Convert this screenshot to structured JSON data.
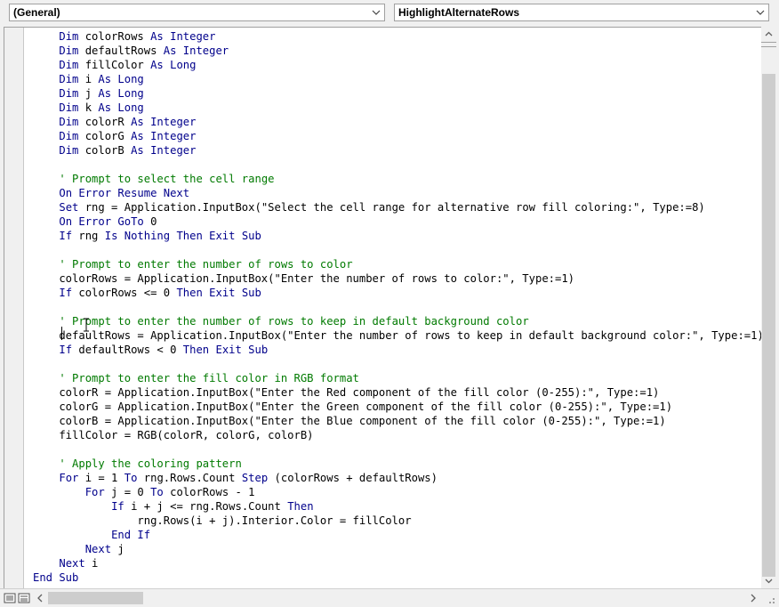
{
  "toolbar": {
    "object_combo": "(General)",
    "procedure_combo": "HighlightAlternateRows"
  },
  "code": {
    "lines": [
      [
        {
          "t": "    "
        },
        {
          "k": "kw",
          "t": "Dim"
        },
        {
          "t": " colorRows "
        },
        {
          "k": "kw",
          "t": "As Integer"
        }
      ],
      [
        {
          "t": "    "
        },
        {
          "k": "kw",
          "t": "Dim"
        },
        {
          "t": " defaultRows "
        },
        {
          "k": "kw",
          "t": "As Integer"
        }
      ],
      [
        {
          "t": "    "
        },
        {
          "k": "kw",
          "t": "Dim"
        },
        {
          "t": " fillColor "
        },
        {
          "k": "kw",
          "t": "As Long"
        }
      ],
      [
        {
          "t": "    "
        },
        {
          "k": "kw",
          "t": "Dim"
        },
        {
          "t": " i "
        },
        {
          "k": "kw",
          "t": "As Long"
        }
      ],
      [
        {
          "t": "    "
        },
        {
          "k": "kw",
          "t": "Dim"
        },
        {
          "t": " j "
        },
        {
          "k": "kw",
          "t": "As Long"
        }
      ],
      [
        {
          "t": "    "
        },
        {
          "k": "kw",
          "t": "Dim"
        },
        {
          "t": " k "
        },
        {
          "k": "kw",
          "t": "As Long"
        }
      ],
      [
        {
          "t": "    "
        },
        {
          "k": "kw",
          "t": "Dim"
        },
        {
          "t": " colorR "
        },
        {
          "k": "kw",
          "t": "As Integer"
        }
      ],
      [
        {
          "t": "    "
        },
        {
          "k": "kw",
          "t": "Dim"
        },
        {
          "t": " colorG "
        },
        {
          "k": "kw",
          "t": "As Integer"
        }
      ],
      [
        {
          "t": "    "
        },
        {
          "k": "kw",
          "t": "Dim"
        },
        {
          "t": " colorB "
        },
        {
          "k": "kw",
          "t": "As Integer"
        }
      ],
      [],
      [
        {
          "t": "    "
        },
        {
          "k": "cm",
          "t": "' Prompt to select the cell range"
        }
      ],
      [
        {
          "t": "    "
        },
        {
          "k": "kw",
          "t": "On Error Resume Next"
        }
      ],
      [
        {
          "t": "    "
        },
        {
          "k": "kw",
          "t": "Set"
        },
        {
          "t": " rng = Application.InputBox(\"Select the cell range for alternative row fill coloring:\", Type:=8)"
        }
      ],
      [
        {
          "t": "    "
        },
        {
          "k": "kw",
          "t": "On Error GoTo"
        },
        {
          "t": " 0"
        }
      ],
      [
        {
          "t": "    "
        },
        {
          "k": "kw",
          "t": "If"
        },
        {
          "t": " rng "
        },
        {
          "k": "kw",
          "t": "Is Nothing Then Exit Sub"
        }
      ],
      [],
      [
        {
          "t": "    "
        },
        {
          "k": "cm",
          "t": "' Prompt to enter the number of rows to color"
        }
      ],
      [
        {
          "t": "    colorRows = Application.InputBox(\"Enter the number of rows to color:\", Type:=1)"
        }
      ],
      [
        {
          "t": "    "
        },
        {
          "k": "kw",
          "t": "If"
        },
        {
          "t": " colorRows <= 0 "
        },
        {
          "k": "kw",
          "t": "Then Exit Sub"
        }
      ],
      [],
      [
        {
          "t": "    "
        },
        {
          "k": "cm",
          "t": "' Prompt to enter the number of rows to keep in default background color"
        }
      ],
      [
        {
          "t": "    defaultRows = Application.InputBox(\"Enter the number of rows to keep in default background color:\", Type:=1)"
        }
      ],
      [
        {
          "t": "    "
        },
        {
          "k": "kw",
          "t": "If"
        },
        {
          "t": " defaultRows < 0 "
        },
        {
          "k": "kw",
          "t": "Then Exit Sub"
        }
      ],
      [],
      [
        {
          "t": "    "
        },
        {
          "k": "cm",
          "t": "' Prompt to enter the fill color in RGB format"
        }
      ],
      [
        {
          "t": "    colorR = Application.InputBox(\"Enter the Red component of the fill color (0-255):\", Type:=1)"
        }
      ],
      [
        {
          "t": "    colorG = Application.InputBox(\"Enter the Green component of the fill color (0-255):\", Type:=1)"
        }
      ],
      [
        {
          "t": "    colorB = Application.InputBox(\"Enter the Blue component of the fill color (0-255):\", Type:=1)"
        }
      ],
      [
        {
          "t": "    fillColor = RGB(colorR, colorG, colorB)"
        }
      ],
      [],
      [
        {
          "t": "    "
        },
        {
          "k": "cm",
          "t": "' Apply the coloring pattern"
        }
      ],
      [
        {
          "t": "    "
        },
        {
          "k": "kw",
          "t": "For"
        },
        {
          "t": " i = 1 "
        },
        {
          "k": "kw",
          "t": "To"
        },
        {
          "t": " rng.Rows.Count "
        },
        {
          "k": "kw",
          "t": "Step"
        },
        {
          "t": " (colorRows + defaultRows)"
        }
      ],
      [
        {
          "t": "        "
        },
        {
          "k": "kw",
          "t": "For"
        },
        {
          "t": " j = 0 "
        },
        {
          "k": "kw",
          "t": "To"
        },
        {
          "t": " colorRows - 1"
        }
      ],
      [
        {
          "t": "            "
        },
        {
          "k": "kw",
          "t": "If"
        },
        {
          "t": " i + j <= rng.Rows.Count "
        },
        {
          "k": "kw",
          "t": "Then"
        }
      ],
      [
        {
          "t": "                rng.Rows(i + j).Interior.Color = fillColor"
        }
      ],
      [
        {
          "t": "            "
        },
        {
          "k": "kw",
          "t": "End If"
        }
      ],
      [
        {
          "t": "        "
        },
        {
          "k": "kw",
          "t": "Next"
        },
        {
          "t": " j"
        }
      ],
      [
        {
          "t": "    "
        },
        {
          "k": "kw",
          "t": "Next"
        },
        {
          "t": " i"
        }
      ],
      [
        {
          "k": "kw",
          "t": "End Sub"
        }
      ]
    ]
  },
  "colors": {
    "keyword": "#00008b",
    "comment": "#007a00",
    "text": "#000000",
    "scroll_thumb": "#cdcdcd"
  },
  "icons": {
    "combo_arrow": "chevron-down-icon",
    "scroll_up": "chevron-up-icon",
    "scroll_down": "chevron-down-icon",
    "scroll_left": "chevron-left-icon",
    "scroll_right": "chevron-right-icon",
    "procedure_view": "procedure-view-icon",
    "full_module_view": "full-module-view-icon"
  }
}
